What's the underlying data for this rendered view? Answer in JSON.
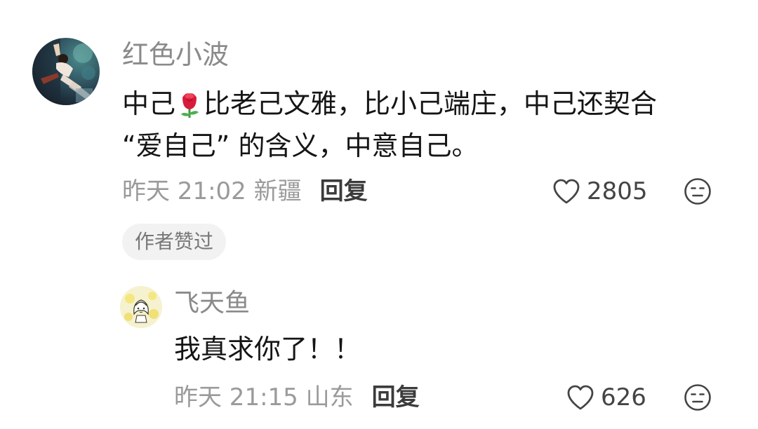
{
  "main_comment": {
    "username": "红色小波",
    "text_line1_a": "中己",
    "text_line1_emoji": "rose-emoji",
    "text_line1_b": "比老己文雅，比小己端庄，中己还契合",
    "text_line2": "“爱自己” 的含义，中意自己。",
    "time": "昨天 21:02",
    "location": "新疆",
    "reply_label": "回复",
    "like_count": "2805",
    "badge": "作者赞过",
    "icons": [
      "heart-outline-icon",
      "meh-face-icon"
    ]
  },
  "reply_comment": {
    "username": "飞天鱼",
    "text": "我真求你了！！",
    "time": "昨天 21:15",
    "location": "山东",
    "reply_label": "回复",
    "like_count": "626",
    "icons": [
      "heart-outline-icon",
      "meh-face-icon"
    ]
  },
  "colors": {
    "username": "#8a8a8a",
    "text": "#151515",
    "meta": "#9a9a9a",
    "reply": "#3b3b3b",
    "badge_bg": "#f2f2f2"
  }
}
